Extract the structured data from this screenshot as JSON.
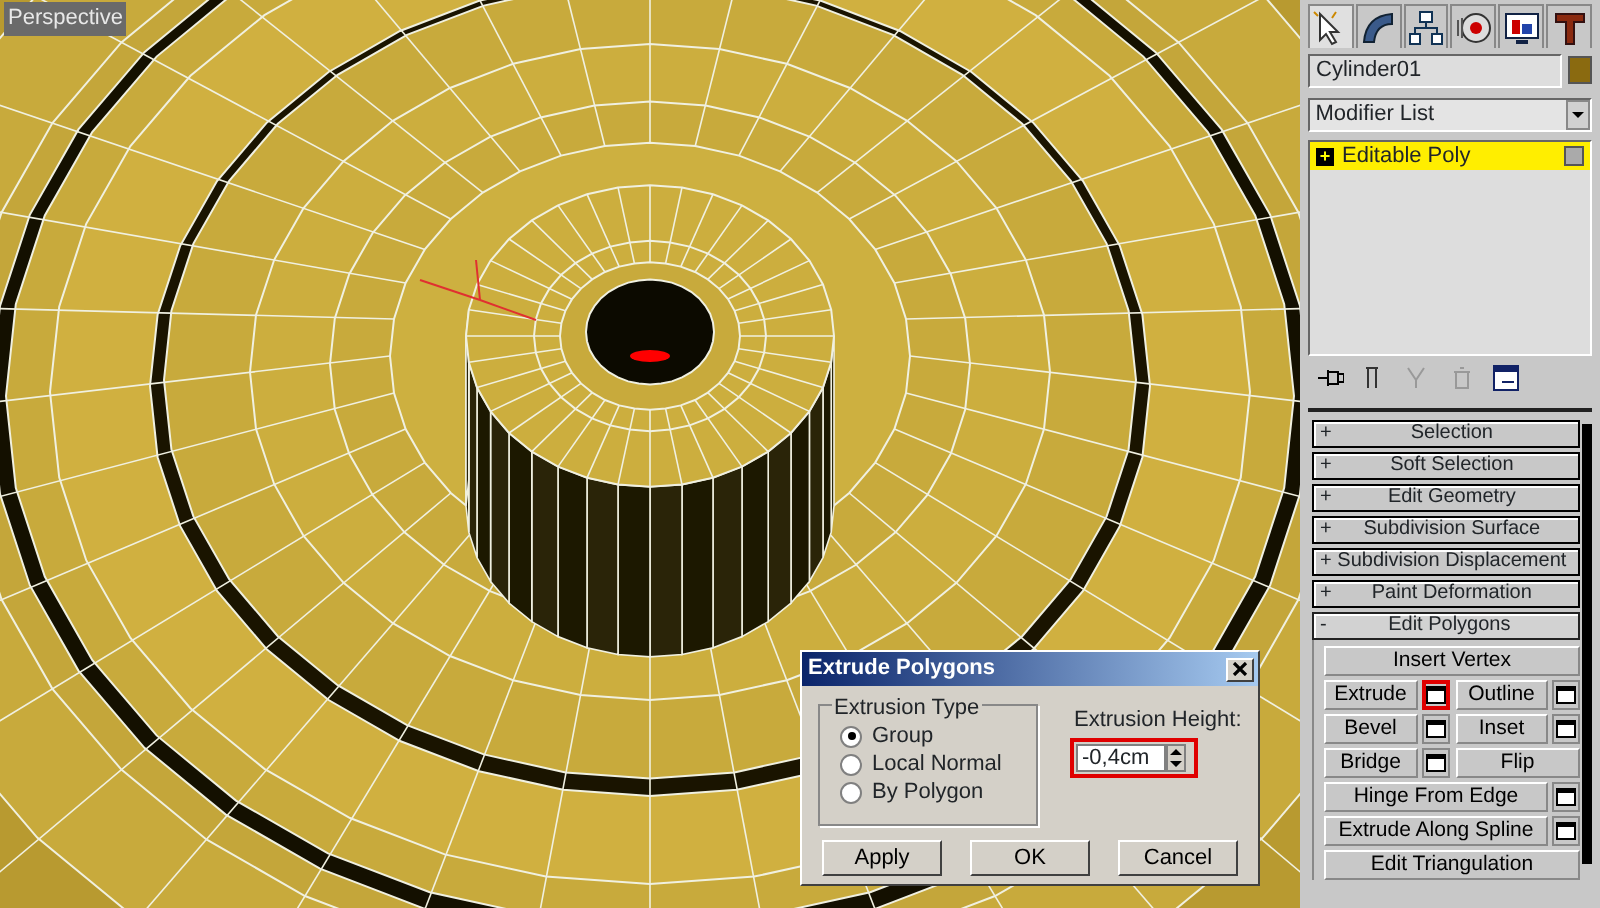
{
  "viewport": {
    "label": "Perspective"
  },
  "command_panel": {
    "tabs": [
      {
        "selected": true
      },
      {
        "selected": false
      },
      {
        "selected": false
      },
      {
        "selected": false
      },
      {
        "selected": false
      },
      {
        "selected": false
      }
    ],
    "object_name": "Cylinder01",
    "modifier_list": "Modifier List",
    "stack": [
      {
        "sign": "+",
        "label": "Editable Poly",
        "selected": true
      }
    ],
    "rollouts": [
      {
        "sign": "+",
        "label": "Selection",
        "expanded": false
      },
      {
        "sign": "+",
        "label": "Soft Selection",
        "expanded": false
      },
      {
        "sign": "+",
        "label": "Edit Geometry",
        "expanded": false
      },
      {
        "sign": "+",
        "label": "Subdivision Surface",
        "expanded": false
      },
      {
        "sign": "+",
        "label": "Subdivision Displacement",
        "expanded": false
      },
      {
        "sign": "+",
        "label": "Paint Deformation",
        "expanded": false
      },
      {
        "sign": "-",
        "label": "Edit Polygons",
        "expanded": true
      }
    ],
    "edit_polygons": [
      [
        {
          "label": "Insert Vertex",
          "settings": false,
          "highlighted": false
        }
      ],
      [
        {
          "label": "Extrude",
          "settings": true,
          "highlighted": true
        },
        {
          "label": "Outline",
          "settings": true,
          "highlighted": false
        }
      ],
      [
        {
          "label": "Bevel",
          "settings": true,
          "highlighted": false
        },
        {
          "label": "Inset",
          "settings": true,
          "highlighted": false
        }
      ],
      [
        {
          "label": "Bridge",
          "settings": true,
          "highlighted": false
        },
        {
          "label": "Flip",
          "settings": false,
          "highlighted": false
        }
      ],
      [
        {
          "label": "Hinge From Edge",
          "settings": true,
          "highlighted": false
        }
      ],
      [
        {
          "label": "Extrude Along Spline",
          "settings": true,
          "highlighted": false
        }
      ],
      [
        {
          "label": "Edit Triangulation",
          "settings": false,
          "highlighted": false
        }
      ]
    ]
  },
  "dialog": {
    "title": "Extrude Polygons",
    "group_label": "Extrusion Type",
    "options": [
      {
        "label": "Group",
        "selected": true
      },
      {
        "label": "Local Normal",
        "selected": false
      },
      {
        "label": "By Polygon",
        "selected": false
      }
    ],
    "height_label": "Extrusion Height:",
    "height_value": "-0,4cm",
    "height_highlighted": true,
    "buttons": [
      "Apply",
      "OK",
      "Cancel"
    ]
  }
}
